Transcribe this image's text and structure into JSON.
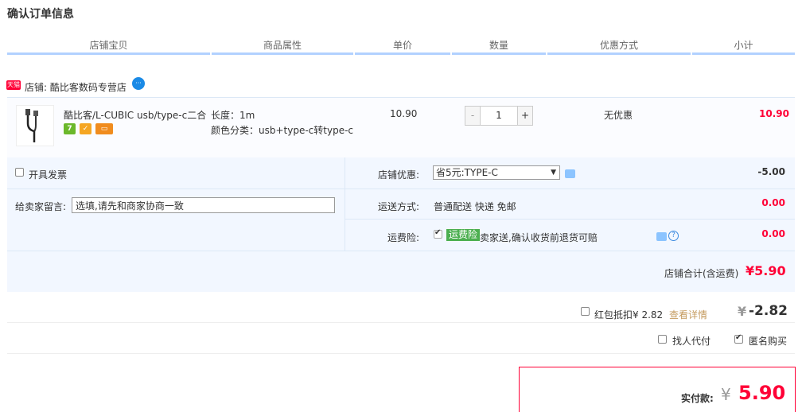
{
  "page": {
    "title": "确认订单信息"
  },
  "columns": [
    "店铺宝贝",
    "商品属性",
    "单价",
    "数量",
    "优惠方式",
    "小计"
  ],
  "shop": {
    "badge": "天猫",
    "label": "店铺: 酷比客数码专营店"
  },
  "item": {
    "name": "酷比客/L-CUBIC usb/type-c二合…",
    "attr_length": "长度：1m",
    "attr_color": "颜色分类：usb+type-c转type-c",
    "price": "10.90",
    "quantity": "1",
    "minus": "-",
    "plus": "+",
    "promo": "无优惠",
    "subtotal": "10.90",
    "badges": [
      {
        "text": "7",
        "color": "#6bb82b"
      },
      {
        "text": "✓",
        "color": "#f5a623"
      },
      {
        "text": "▭",
        "color": "#f08c1e"
      }
    ]
  },
  "invoice": {
    "label": "开具发票",
    "checked": false
  },
  "message": {
    "label": "给卖家留言:",
    "placeholder": "选填,请先和商家协商一致"
  },
  "shop_discount": {
    "label": "店铺优惠:",
    "selected": "省5元:TYPE-C",
    "amount": "-5.00"
  },
  "shipping": {
    "label": "运送方式:",
    "value": "普通配送 快递 免邮",
    "amount": "0.00"
  },
  "insurance": {
    "label": "运费险:",
    "tag": "运费险",
    "text": "卖家送,确认收货前退货可赔",
    "amount": "0.00",
    "checked": true
  },
  "shop_total": {
    "label": "店铺合计(含运费)",
    "value": "¥5.90"
  },
  "red_packet": {
    "label": "红包抵扣¥ 2.82",
    "link": "查看详情",
    "amount_yen": "¥",
    "amount": "-2.82",
    "checked": false
  },
  "options": {
    "proxy_pay": "找人代付",
    "anonymous": "匿名购买",
    "anonymous_checked": true
  },
  "payment": {
    "label": "实付款:",
    "yen": "¥",
    "value": "5.90"
  },
  "colors": {
    "accent": "#ff0036",
    "header_line": "#b2d1ff",
    "panel_bg": "#f2f7ff"
  }
}
